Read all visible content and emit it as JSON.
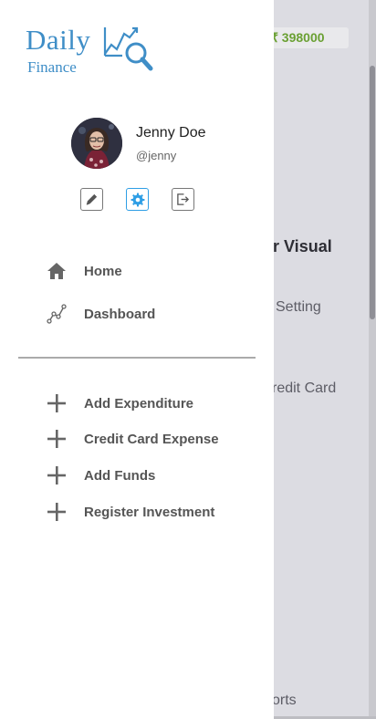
{
  "background": {
    "balance": "₹ 398000",
    "texts": [
      "r Visual",
      "Setting",
      "redit Card",
      "orts"
    ]
  },
  "drawer": {
    "logo": {
      "word1": "Daily",
      "word2": "Finance"
    },
    "user": {
      "name": "Jenny Doe",
      "handle": "@jenny"
    },
    "actions": [
      {
        "name": "edit",
        "icon": "pencil-icon"
      },
      {
        "name": "settings",
        "icon": "gear-icon",
        "active": true
      },
      {
        "name": "logout",
        "icon": "logout-icon"
      }
    ],
    "nav": [
      {
        "label": "Home",
        "icon": "home-icon"
      },
      {
        "label": "Dashboard",
        "icon": "chart-line-icon"
      }
    ],
    "quick_actions": [
      {
        "label": "Add Expenditure",
        "icon": "plus-icon"
      },
      {
        "label": "Credit Card Expense",
        "icon": "plus-icon"
      },
      {
        "label": "Add Funds",
        "icon": "plus-icon"
      },
      {
        "label": "Register Investment",
        "icon": "plus-icon"
      }
    ]
  },
  "colors": {
    "accent": "#2e9ee5",
    "brand": "#3f8ec7",
    "balance_green": "#6aa033"
  }
}
